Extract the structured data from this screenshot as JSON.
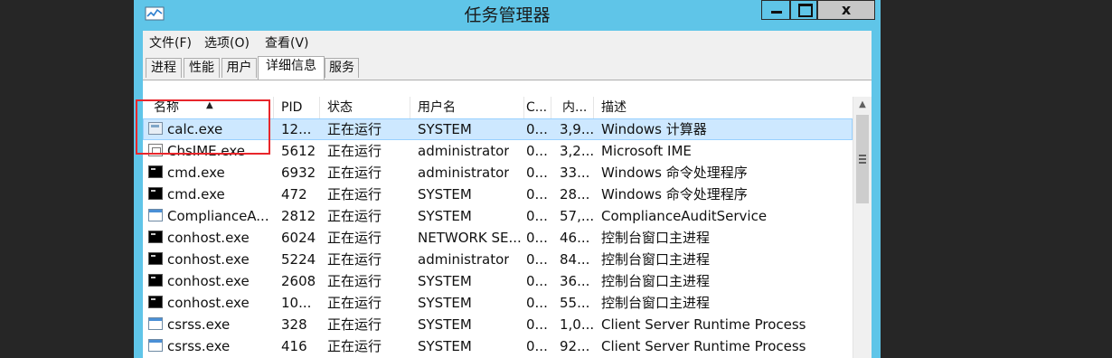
{
  "window": {
    "title": "任务管理器",
    "controls": {
      "minimize": "minimize",
      "maximize": "maximize",
      "close": "x"
    }
  },
  "menu": [
    "文件(F)",
    "选项(O)",
    "查看(V)"
  ],
  "tabs": [
    {
      "label": "进程",
      "active": false
    },
    {
      "label": "性能",
      "active": false
    },
    {
      "label": "用户",
      "active": false
    },
    {
      "label": "详细信息",
      "active": true
    },
    {
      "label": "服务",
      "active": false
    }
  ],
  "table": {
    "columns": [
      "名称",
      "PID",
      "状态",
      "用户名",
      "C...",
      "内...",
      "描述"
    ],
    "rows": [
      {
        "icon": "calculator-icon",
        "name": "calc.exe",
        "pid": "12...",
        "status": "正在运行",
        "user": "SYSTEM",
        "cpu": "0...",
        "mem": "3,9...",
        "desc": "Windows 计算器",
        "selected": true
      },
      {
        "icon": "ime-icon",
        "name": "ChsIME.exe",
        "pid": "5612",
        "status": "正在运行",
        "user": "administrator",
        "cpu": "0...",
        "mem": "3,2...",
        "desc": "Microsoft IME",
        "selected": false
      },
      {
        "icon": "console-icon",
        "name": "cmd.exe",
        "pid": "6932",
        "status": "正在运行",
        "user": "administrator",
        "cpu": "0...",
        "mem": "33...",
        "desc": "Windows 命令处理程序",
        "selected": false
      },
      {
        "icon": "console-icon",
        "name": "cmd.exe",
        "pid": "472",
        "status": "正在运行",
        "user": "SYSTEM",
        "cpu": "0...",
        "mem": "28...",
        "desc": "Windows 命令处理程序",
        "selected": false
      },
      {
        "icon": "app-window-icon",
        "name": "ComplianceA...",
        "pid": "2812",
        "status": "正在运行",
        "user": "SYSTEM",
        "cpu": "0...",
        "mem": "57,...",
        "desc": "ComplianceAuditService",
        "selected": false
      },
      {
        "icon": "console-icon",
        "name": "conhost.exe",
        "pid": "6024",
        "status": "正在运行",
        "user": "NETWORK SE...",
        "cpu": "0...",
        "mem": "46...",
        "desc": "控制台窗口主进程",
        "selected": false
      },
      {
        "icon": "console-icon",
        "name": "conhost.exe",
        "pid": "5224",
        "status": "正在运行",
        "user": "administrator",
        "cpu": "0...",
        "mem": "84...",
        "desc": "控制台窗口主进程",
        "selected": false
      },
      {
        "icon": "console-icon",
        "name": "conhost.exe",
        "pid": "2608",
        "status": "正在运行",
        "user": "SYSTEM",
        "cpu": "0...",
        "mem": "36...",
        "desc": "控制台窗口主进程",
        "selected": false
      },
      {
        "icon": "console-icon",
        "name": "conhost.exe",
        "pid": "10...",
        "status": "正在运行",
        "user": "SYSTEM",
        "cpu": "0...",
        "mem": "55...",
        "desc": "控制台窗口主进程",
        "selected": false
      },
      {
        "icon": "app-window-icon",
        "name": "csrss.exe",
        "pid": "328",
        "status": "正在运行",
        "user": "SYSTEM",
        "cpu": "0...",
        "mem": "1,0...",
        "desc": "Client Server Runtime Process",
        "selected": false
      },
      {
        "icon": "app-window-icon",
        "name": "csrss.exe",
        "pid": "416",
        "status": "正在运行",
        "user": "SYSTEM",
        "cpu": "0...",
        "mem": "92...",
        "desc": "Client Server Runtime Process",
        "selected": false
      }
    ]
  },
  "colors": {
    "titlebar": "#5fc5e8",
    "selection": "#cde8ff",
    "highlight_box": "#e8262b"
  }
}
